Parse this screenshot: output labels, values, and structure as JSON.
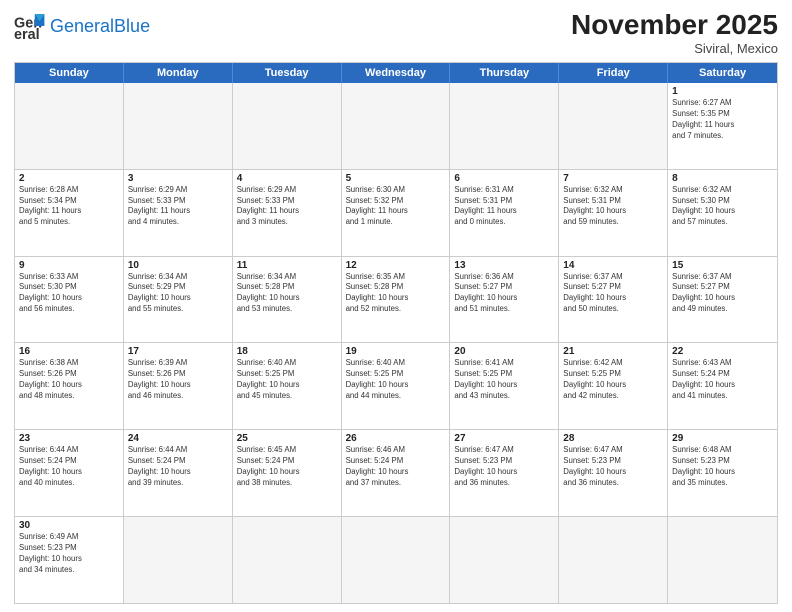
{
  "header": {
    "logo_general": "General",
    "logo_blue": "Blue",
    "month_year": "November 2025",
    "location": "Siviral, Mexico"
  },
  "weekdays": [
    "Sunday",
    "Monday",
    "Tuesday",
    "Wednesday",
    "Thursday",
    "Friday",
    "Saturday"
  ],
  "rows": [
    [
      {
        "day": "",
        "info": "",
        "empty": true
      },
      {
        "day": "",
        "info": "",
        "empty": true
      },
      {
        "day": "",
        "info": "",
        "empty": true
      },
      {
        "day": "",
        "info": "",
        "empty": true
      },
      {
        "day": "",
        "info": "",
        "empty": true
      },
      {
        "day": "",
        "info": "",
        "empty": true
      },
      {
        "day": "1",
        "info": "Sunrise: 6:27 AM\nSunset: 5:35 PM\nDaylight: 11 hours\nand 7 minutes."
      }
    ],
    [
      {
        "day": "2",
        "info": "Sunrise: 6:28 AM\nSunset: 5:34 PM\nDaylight: 11 hours\nand 5 minutes."
      },
      {
        "day": "3",
        "info": "Sunrise: 6:29 AM\nSunset: 5:33 PM\nDaylight: 11 hours\nand 4 minutes."
      },
      {
        "day": "4",
        "info": "Sunrise: 6:29 AM\nSunset: 5:33 PM\nDaylight: 11 hours\nand 3 minutes."
      },
      {
        "day": "5",
        "info": "Sunrise: 6:30 AM\nSunset: 5:32 PM\nDaylight: 11 hours\nand 1 minute."
      },
      {
        "day": "6",
        "info": "Sunrise: 6:31 AM\nSunset: 5:31 PM\nDaylight: 11 hours\nand 0 minutes."
      },
      {
        "day": "7",
        "info": "Sunrise: 6:32 AM\nSunset: 5:31 PM\nDaylight: 10 hours\nand 59 minutes."
      },
      {
        "day": "8",
        "info": "Sunrise: 6:32 AM\nSunset: 5:30 PM\nDaylight: 10 hours\nand 57 minutes."
      }
    ],
    [
      {
        "day": "9",
        "info": "Sunrise: 6:33 AM\nSunset: 5:30 PM\nDaylight: 10 hours\nand 56 minutes."
      },
      {
        "day": "10",
        "info": "Sunrise: 6:34 AM\nSunset: 5:29 PM\nDaylight: 10 hours\nand 55 minutes."
      },
      {
        "day": "11",
        "info": "Sunrise: 6:34 AM\nSunset: 5:28 PM\nDaylight: 10 hours\nand 53 minutes."
      },
      {
        "day": "12",
        "info": "Sunrise: 6:35 AM\nSunset: 5:28 PM\nDaylight: 10 hours\nand 52 minutes."
      },
      {
        "day": "13",
        "info": "Sunrise: 6:36 AM\nSunset: 5:27 PM\nDaylight: 10 hours\nand 51 minutes."
      },
      {
        "day": "14",
        "info": "Sunrise: 6:37 AM\nSunset: 5:27 PM\nDaylight: 10 hours\nand 50 minutes."
      },
      {
        "day": "15",
        "info": "Sunrise: 6:37 AM\nSunset: 5:27 PM\nDaylight: 10 hours\nand 49 minutes."
      }
    ],
    [
      {
        "day": "16",
        "info": "Sunrise: 6:38 AM\nSunset: 5:26 PM\nDaylight: 10 hours\nand 48 minutes."
      },
      {
        "day": "17",
        "info": "Sunrise: 6:39 AM\nSunset: 5:26 PM\nDaylight: 10 hours\nand 46 minutes."
      },
      {
        "day": "18",
        "info": "Sunrise: 6:40 AM\nSunset: 5:25 PM\nDaylight: 10 hours\nand 45 minutes."
      },
      {
        "day": "19",
        "info": "Sunrise: 6:40 AM\nSunset: 5:25 PM\nDaylight: 10 hours\nand 44 minutes."
      },
      {
        "day": "20",
        "info": "Sunrise: 6:41 AM\nSunset: 5:25 PM\nDaylight: 10 hours\nand 43 minutes."
      },
      {
        "day": "21",
        "info": "Sunrise: 6:42 AM\nSunset: 5:25 PM\nDaylight: 10 hours\nand 42 minutes."
      },
      {
        "day": "22",
        "info": "Sunrise: 6:43 AM\nSunset: 5:24 PM\nDaylight: 10 hours\nand 41 minutes."
      }
    ],
    [
      {
        "day": "23",
        "info": "Sunrise: 6:44 AM\nSunset: 5:24 PM\nDaylight: 10 hours\nand 40 minutes."
      },
      {
        "day": "24",
        "info": "Sunrise: 6:44 AM\nSunset: 5:24 PM\nDaylight: 10 hours\nand 39 minutes."
      },
      {
        "day": "25",
        "info": "Sunrise: 6:45 AM\nSunset: 5:24 PM\nDaylight: 10 hours\nand 38 minutes."
      },
      {
        "day": "26",
        "info": "Sunrise: 6:46 AM\nSunset: 5:24 PM\nDaylight: 10 hours\nand 37 minutes."
      },
      {
        "day": "27",
        "info": "Sunrise: 6:47 AM\nSunset: 5:23 PM\nDaylight: 10 hours\nand 36 minutes."
      },
      {
        "day": "28",
        "info": "Sunrise: 6:47 AM\nSunset: 5:23 PM\nDaylight: 10 hours\nand 36 minutes."
      },
      {
        "day": "29",
        "info": "Sunrise: 6:48 AM\nSunset: 5:23 PM\nDaylight: 10 hours\nand 35 minutes."
      }
    ],
    [
      {
        "day": "30",
        "info": "Sunrise: 6:49 AM\nSunset: 5:23 PM\nDaylight: 10 hours\nand 34 minutes."
      },
      {
        "day": "",
        "info": "",
        "empty": true
      },
      {
        "day": "",
        "info": "",
        "empty": true
      },
      {
        "day": "",
        "info": "",
        "empty": true
      },
      {
        "day": "",
        "info": "",
        "empty": true
      },
      {
        "day": "",
        "info": "",
        "empty": true
      },
      {
        "day": "",
        "info": "",
        "empty": true
      }
    ]
  ]
}
